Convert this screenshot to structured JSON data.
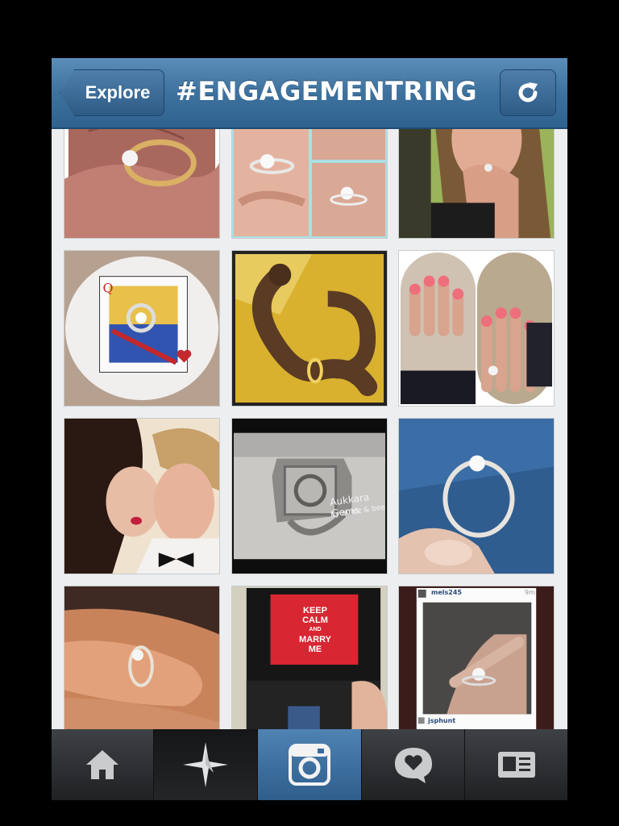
{
  "header": {
    "back_label": "Explore",
    "title": "#ENGAGEMENTRING",
    "refresh_icon": "refresh-icon"
  },
  "grid": {
    "tiles": [
      {
        "name": "photo-ring-in-palm"
      },
      {
        "name": "photo-ring-collage"
      },
      {
        "name": "photo-girl-hand-on-face"
      },
      {
        "name": "photo-queen-card-ring"
      },
      {
        "name": "photo-snake-ring"
      },
      {
        "name": "photo-pink-nails-ring"
      },
      {
        "name": "photo-couple-kiss"
      },
      {
        "name": "photo-signet-ring"
      },
      {
        "name": "photo-ring-on-denim"
      },
      {
        "name": "photo-ring-on-finger"
      },
      {
        "name": "photo-keep-calm-box"
      },
      {
        "name": "photo-repost-ring"
      }
    ],
    "watermark": "Aukkara Gems",
    "watermark_sub": "by aumz & bee",
    "keep_calm_lines": [
      "KEEP",
      "CALM",
      "AND",
      "MARRY",
      "ME"
    ],
    "repost_user": "mels245",
    "repost_time": "9m",
    "repost_commenter": "jsphunt"
  },
  "tabbar": {
    "tabs": [
      "home-icon",
      "explore-star-icon",
      "camera-icon",
      "news-heart-icon",
      "profile-icon"
    ],
    "active": "camera-icon"
  },
  "colors": {
    "navbar": "#3f739f",
    "active_tab": "#4f83b3"
  }
}
